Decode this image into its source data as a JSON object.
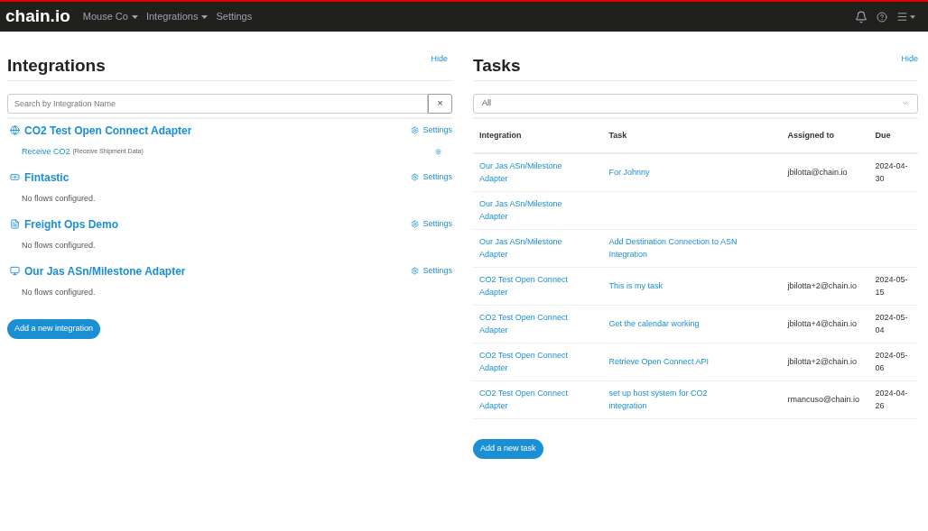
{
  "navbar": {
    "logo": "chain.io",
    "menus": [
      {
        "label": "Mouse Co",
        "dropdown": true
      },
      {
        "label": "Integrations",
        "dropdown": true
      },
      {
        "label": "Settings",
        "dropdown": false
      }
    ]
  },
  "integrations": {
    "title": "Integrations",
    "hide": "Hide",
    "search": {
      "placeholder": "Search by Integration Name",
      "clear": "×"
    },
    "items": [
      {
        "kind": "globe",
        "name": "CO2 Test Open Connect Adapter",
        "settings": "Settings",
        "flows": [
          {
            "name": "Receive CO2",
            "detail": "(Receive Shipment Data)"
          }
        ]
      },
      {
        "kind": "money",
        "name": "Fintastic",
        "settings": "Settings",
        "empty": "No flows configured."
      },
      {
        "kind": "document",
        "name": "Freight Ops Demo",
        "settings": "Settings",
        "empty": "No flows configured."
      },
      {
        "kind": "screen",
        "name": "Our Jas ASn/Milestone Adapter",
        "settings": "Settings",
        "empty": "No flows configured."
      }
    ],
    "add": "Add a new integration"
  },
  "tasks": {
    "title": "Tasks",
    "hide": "Hide",
    "filter": "All",
    "columns": [
      "Integration",
      "Task",
      "Assigned to",
      "Due"
    ],
    "rows": [
      {
        "integration": "Our Jas ASn/Milestone Adapter",
        "task": "For Johnny",
        "assigned": "jbilotta@chain.io",
        "due": "2024-04-30"
      },
      {
        "integration": "Our Jas ASn/Milestone Adapter"
      },
      {
        "integration": "Our Jas ASn/Milestone Adapter",
        "task": "Add Destination Connection to ASN Integration"
      },
      {
        "integration": "CO2 Test Open Connect Adapter",
        "task": "This is my task",
        "assigned": "jbilotta+2@chain.io",
        "due": "2024-05-15"
      },
      {
        "integration": "CO2 Test Open Connect Adapter",
        "task": "Get the calendar working",
        "assigned": "jbilotta+4@chain.io",
        "due": "2024-05-04"
      },
      {
        "integration": "CO2 Test Open Connect Adapter",
        "task": "Retrieve Open Connect API",
        "assigned": "jbilotta+2@chain.io",
        "due": "2024-05-06"
      },
      {
        "integration": "CO2 Test Open Connect Adapter",
        "task": "set up host system for CO2 integration",
        "assigned": "rmancuso@chain.io",
        "due": "2024-04-26"
      }
    ],
    "add": "Add a new task"
  }
}
